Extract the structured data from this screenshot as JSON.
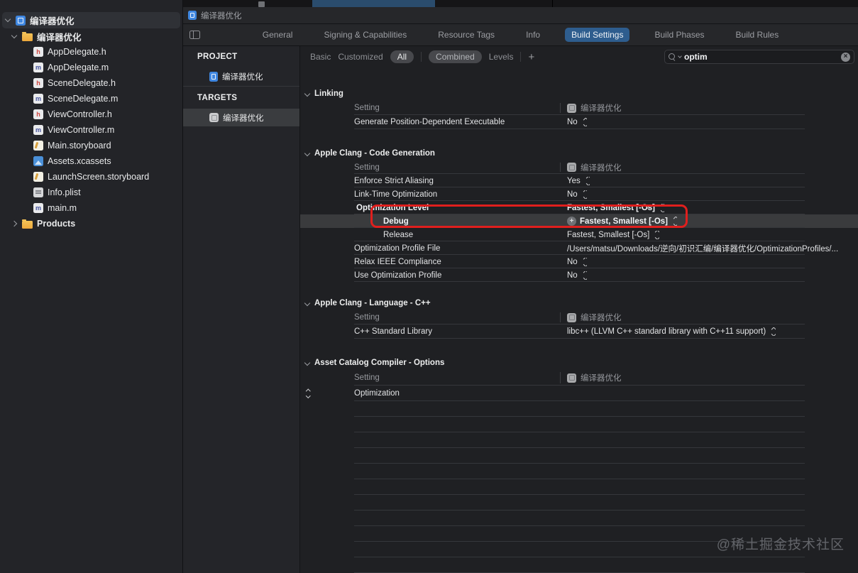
{
  "sidebar": {
    "project_row": {
      "label": "编译器优化"
    },
    "group_row": {
      "label": "编译器优化"
    },
    "files": [
      {
        "label": "AppDelegate.h",
        "type": "h"
      },
      {
        "label": "AppDelegate.m",
        "type": "m"
      },
      {
        "label": "SceneDelegate.h",
        "type": "h"
      },
      {
        "label": "SceneDelegate.m",
        "type": "m"
      },
      {
        "label": "ViewController.h",
        "type": "h"
      },
      {
        "label": "ViewController.m",
        "type": "m"
      },
      {
        "label": "Main.storyboard",
        "type": "storyboard"
      },
      {
        "label": "Assets.xcassets",
        "type": "assets"
      },
      {
        "label": "LaunchScreen.storyboard",
        "type": "storyboard"
      },
      {
        "label": "Info.plist",
        "type": "plist"
      },
      {
        "label": "main.m",
        "type": "m"
      }
    ],
    "products_row": {
      "label": "Products"
    }
  },
  "jumpbar": {
    "label": "编译器优化"
  },
  "tabs": {
    "items": [
      "General",
      "Signing & Capabilities",
      "Resource Tags",
      "Info",
      "Build Settings",
      "Build Phases",
      "Build Rules"
    ],
    "selected": "Build Settings"
  },
  "filter": {
    "scopes": [
      {
        "label": "Basic",
        "selected": false
      },
      {
        "label": "Customized",
        "selected": false
      },
      {
        "label": "All",
        "selected": true
      }
    ],
    "modes": [
      {
        "label": "Combined",
        "selected": true
      },
      {
        "label": "Levels",
        "selected": false
      }
    ],
    "add_label": "+",
    "search": {
      "value": "optim"
    }
  },
  "panel": {
    "project_header": "PROJECT",
    "project_name": "编译器优化",
    "targets_header": "TARGETS",
    "target_name": "编译器优化"
  },
  "settings": {
    "column_setting_label": "Setting",
    "column_target_label": "编译器优化",
    "sections": [
      {
        "title": "Linking",
        "rows": [
          {
            "name": "Generate Position-Dependent Executable",
            "value": "No",
            "stepper": true
          }
        ]
      },
      {
        "title": "Apple Clang - Code Generation",
        "rows": [
          {
            "name": "Enforce Strict Aliasing",
            "value": "Yes",
            "stepper": true
          },
          {
            "name": "Link-Time Optimization",
            "value": "No",
            "stepper": true
          },
          {
            "name": "Optimization Level",
            "value": "Fastest, Smallest [-Os]",
            "stepper": true,
            "bold": true,
            "expanded": true
          },
          {
            "name": "Debug",
            "value": "Fastest, Smallest [-Os]",
            "stepper": true,
            "bold": true,
            "indent": true,
            "selected": true,
            "plus_icon": true
          },
          {
            "name": "Release",
            "value": "Fastest, Smallest [-Os]",
            "stepper": true,
            "indent": true
          },
          {
            "name": "Optimization Profile File",
            "value": "/Users/matsu/Downloads/逆向/初识汇编/编译器优化/OptimizationProfiles/...",
            "stepper": false
          },
          {
            "name": "Relax IEEE Compliance",
            "value": "No",
            "stepper": true
          },
          {
            "name": "Use Optimization Profile",
            "value": "No",
            "stepper": true
          }
        ]
      },
      {
        "title": "Apple Clang - Language - C++",
        "rows": [
          {
            "name": "C++ Standard Library",
            "value": "libc++ (LLVM C++ standard library with C++11 support)",
            "stepper": true
          }
        ]
      },
      {
        "title": "Asset Catalog Compiler - Options",
        "rows": [
          {
            "name": "Optimization",
            "value": "",
            "stepper": false,
            "gutter_stepper": true
          }
        ]
      }
    ]
  },
  "watermark": {
    "text": "@稀土掘金技术社区"
  }
}
